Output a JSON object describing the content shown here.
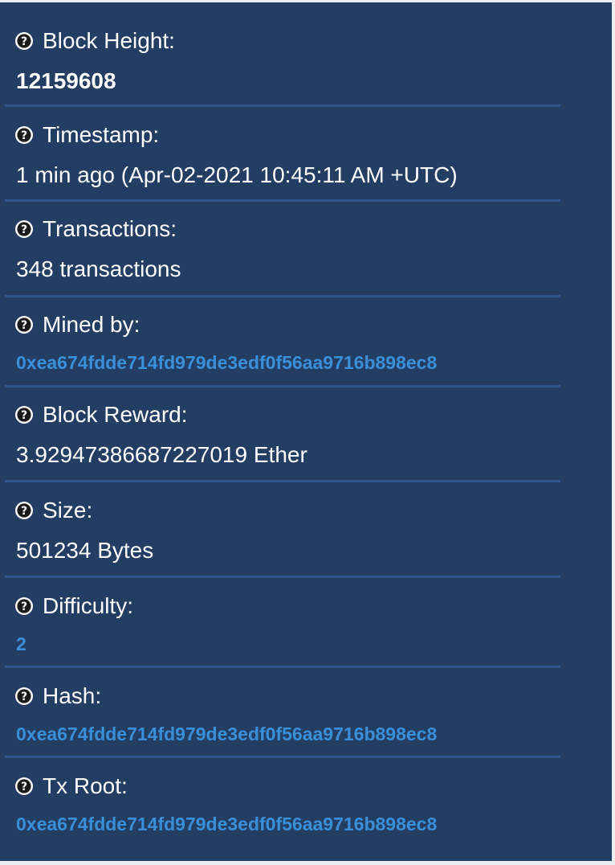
{
  "fields": [
    {
      "label": "Block Height:",
      "value": "12159608"
    },
    {
      "label": "Timestamp:",
      "value": "1 min ago (Apr-02-2021 10:45:11 AM +UTC)"
    },
    {
      "label": "Transactions:",
      "value": "348 transactions"
    },
    {
      "label": "Mined by:",
      "value": "0xea674fdde714fd979de3edf0f56aa9716b898ec8"
    },
    {
      "label": "Block Reward:",
      "value": "3.92947386687227019 Ether"
    },
    {
      "label": "Size:",
      "value": "501234 Bytes"
    },
    {
      "label": "Difficulty:",
      "value": "2"
    },
    {
      "label": "Hash:",
      "value": "0xea674fdde714fd979de3edf0f56aa9716b898ec8"
    },
    {
      "label": "Tx Root:",
      "value": "0xea674fdde714fd979de3edf0f56aa9716b898ec8"
    }
  ],
  "icon": "question-circle-icon",
  "colors": {
    "background": "#233d63",
    "divider": "#2e5489",
    "link": "#3a8fd9",
    "text": "#ffffff"
  }
}
